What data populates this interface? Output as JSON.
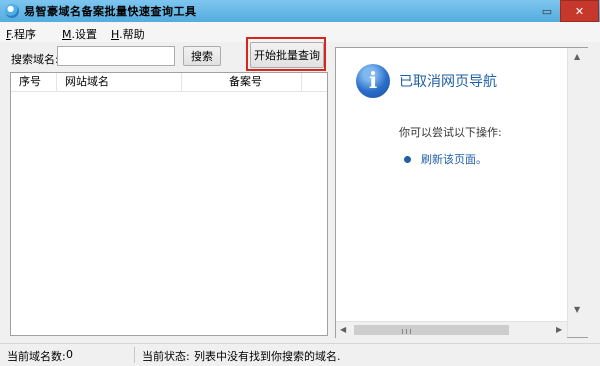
{
  "window": {
    "title": "易智豪域名备案批量快速查询工具",
    "minimize_glyph": "▭",
    "close_glyph": "✕"
  },
  "menu": [
    {
      "accel": "F",
      "label": ".程序"
    },
    {
      "accel": "M",
      "label": ".设置"
    },
    {
      "accel": "H",
      "label": ".帮助"
    }
  ],
  "search": {
    "label": "搜索域名:",
    "value": "",
    "placeholder": "",
    "button_label": "搜索",
    "batch_button_label": "开始批量查询"
  },
  "list": {
    "columns": [
      "序号",
      "网站域名",
      "备案号"
    ],
    "rows": []
  },
  "browser": {
    "heading": "已取消网页导航",
    "hint": "你可以尝试以下操作:",
    "link": "刷新该页面。",
    "icon": "info-icon"
  },
  "status": {
    "domain_count_label": "当前域名数:",
    "domain_count": "0",
    "state_label": "当前状态:",
    "state_text": "列表中没有找到你搜索的域名."
  },
  "colors": {
    "accent": "#1f5fa6",
    "highlight": "#d9261c",
    "titlebar": "#54acde"
  }
}
